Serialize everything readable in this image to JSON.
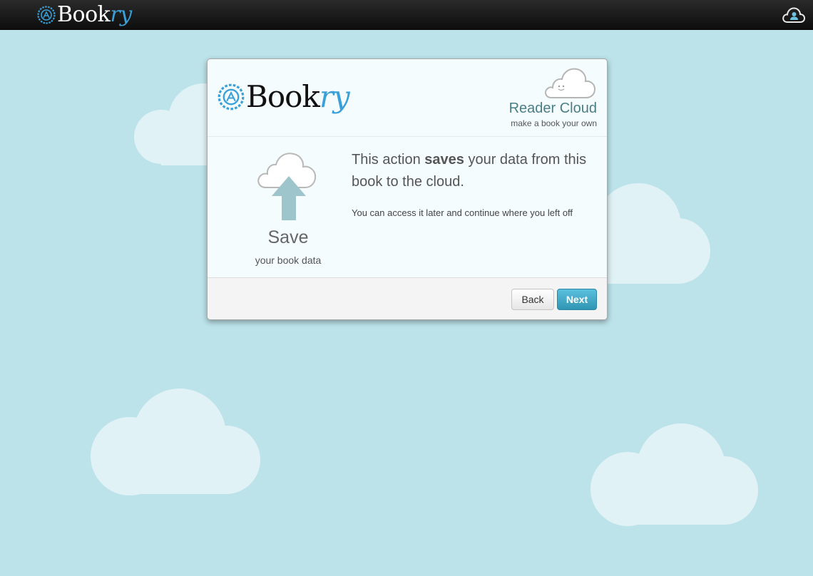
{
  "app": {
    "brand_main": "Book",
    "brand_accent": "ry"
  },
  "topbar": {
    "account_icon": "cloud-user-icon"
  },
  "dialog": {
    "header": {
      "logo_main": "Book",
      "logo_accent": "ry",
      "reader_cloud_title": "Reader Cloud",
      "reader_cloud_subtitle": "make a book your own"
    },
    "action": {
      "title": "Save",
      "subtitle": "your book data",
      "icon": "cloud-upload-icon"
    },
    "message": {
      "prefix": "This action ",
      "bold": "saves",
      "suffix": " your data from this book to the cloud.",
      "detail": "You can access it later and continue where you left off"
    },
    "buttons": {
      "back": "Back",
      "next": "Next"
    }
  },
  "colors": {
    "background": "#bce3ea",
    "accent": "#3aa0d8",
    "primary_button": "#49afcd",
    "topbar": "#1a1a1a"
  }
}
